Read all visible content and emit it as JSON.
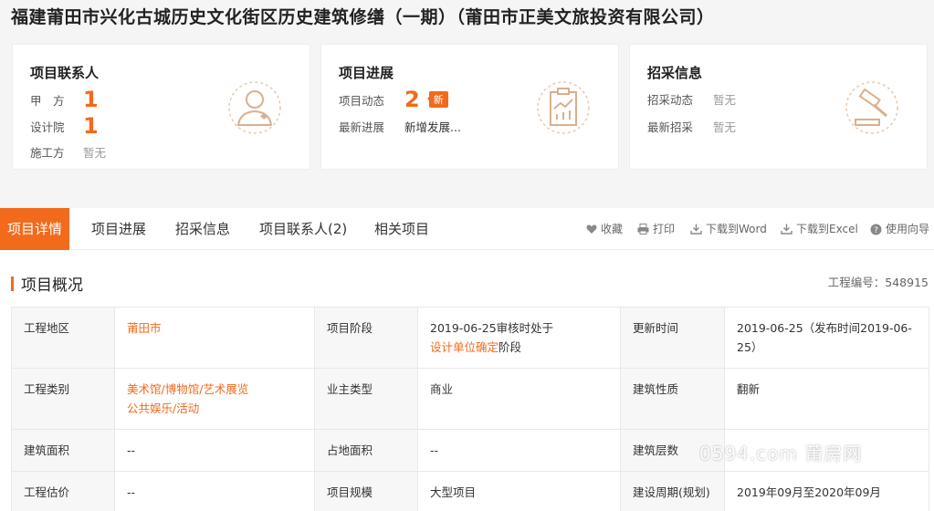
{
  "page_title": "福建莆田市兴化古城历史文化街区历史建筑修缮（一期）（莆田市正美文旅投资有限公司）",
  "cards": {
    "contacts": {
      "title": "项目联系人",
      "rows": [
        {
          "label": "甲　方",
          "value": "1"
        },
        {
          "label": "设计院",
          "value": "1"
        },
        {
          "label": "施工方",
          "value": "暂无"
        }
      ],
      "icon": "person-phone-icon"
    },
    "progress": {
      "title": "项目进展",
      "rows": [
        {
          "label": "项目动态",
          "value": "2",
          "badge": "新"
        },
        {
          "label": "最新进展",
          "value": "新增发展..."
        }
      ],
      "icon": "chart-clipboard-icon"
    },
    "procurement": {
      "title": "招采信息",
      "rows": [
        {
          "label": "招采动态",
          "value": "暂无"
        },
        {
          "label": "最新招采",
          "value": "暂无"
        }
      ],
      "icon": "gavel-icon"
    }
  },
  "tabs": [
    "项目详情",
    "项目进展",
    "招采信息",
    "项目联系人(2)",
    "相关项目"
  ],
  "tools": {
    "favorite": "收藏",
    "print": "打印",
    "word": "下载到Word",
    "excel": "下载到Excel",
    "guide": "使用向导"
  },
  "section": {
    "title": "项目概况",
    "project_no_label": "工程编号：",
    "project_no": "548915"
  },
  "details": {
    "r1": {
      "k1": "工程地区",
      "v1": "莆田市",
      "k2": "项目阶段",
      "v2a": "2019-06-25审核时处于",
      "v2b": "设计单位确定",
      "v2c": "阶段",
      "k3": "更新时间",
      "v3": "2019-06-25（发布时间2019-06-25）"
    },
    "r2": {
      "k1": "工程类别",
      "v1a": "美术馆/博物馆/艺术展览",
      "v1b": "公共娱乐/活动",
      "k2": "业主类型",
      "v2": "商业",
      "k3": "建筑性质",
      "v3": "翻新"
    },
    "r3": {
      "k1": "建筑面积",
      "v1": "--",
      "k2": "占地面积",
      "v2": "--",
      "k3": "建筑层数",
      "v3": ""
    },
    "r4": {
      "k1": "工程估价",
      "v1": "--",
      "k2": "项目规模",
      "v2": "大型项目",
      "k3": "建设周期(规划)",
      "v3": "2019年09月至2020年09月"
    }
  },
  "watermark": "0594.com 莆房网",
  "colors": {
    "accent": "#f26a1b",
    "muted": "#999999"
  }
}
